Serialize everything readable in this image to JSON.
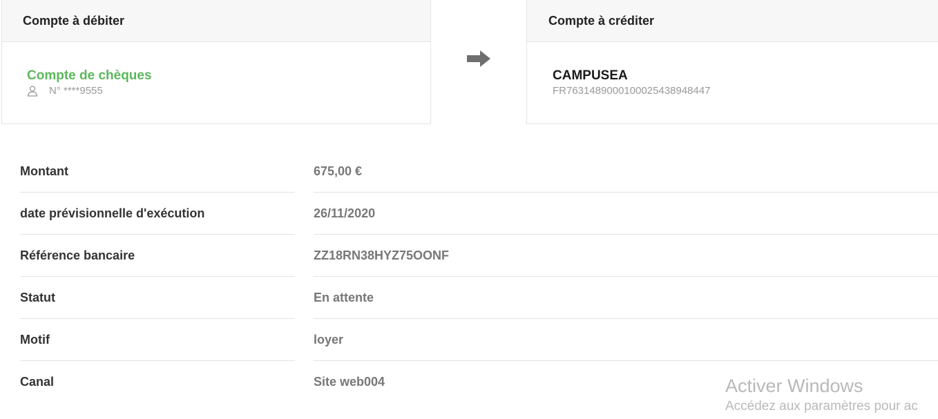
{
  "debit": {
    "header": "Compte à débiter",
    "account_name": "Compte de chèques",
    "account_number": "N° ****9555",
    "icon": "person-icon"
  },
  "transfer_icon": "arrow-right-icon",
  "credit": {
    "header": "Compte à créditer",
    "account_name": "CAMPUSEA",
    "iban": "FR7631489000100025438948447"
  },
  "details": [
    {
      "label": "Montant",
      "value": "675,00 €"
    },
    {
      "label": "date prévisionnelle d'exécution",
      "value": "26/11/2020"
    },
    {
      "label": "Référence bancaire",
      "value": "ZZ18RN38HYZ75OONF"
    },
    {
      "label": "Statut",
      "value": "En attente"
    },
    {
      "label": "Motif",
      "value": "loyer"
    },
    {
      "label": "Canal",
      "value": "Site web004"
    }
  ],
  "watermark": {
    "title": "Activer Windows",
    "subtitle": "Accédez aux paramètres pour ac"
  },
  "colors": {
    "accent_green": "#5cb85c",
    "header_bg": "#f7f7f7",
    "border": "#e3e3e3"
  }
}
